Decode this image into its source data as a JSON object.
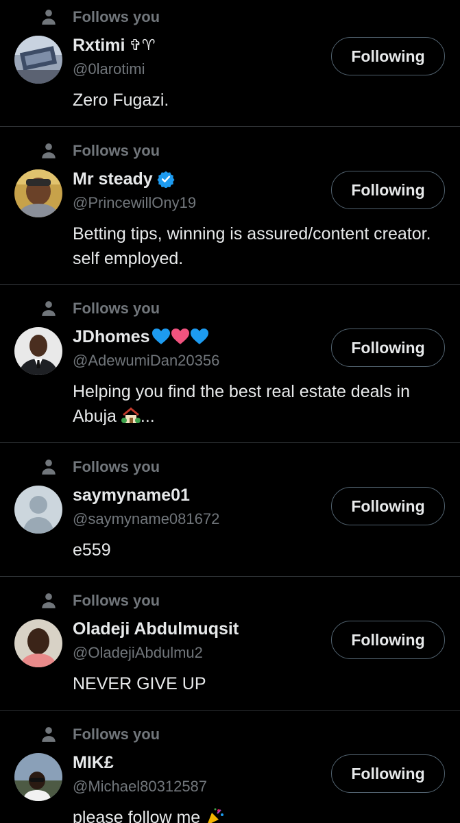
{
  "follows_label": "Follows you",
  "button_label": "Following",
  "accounts": [
    {
      "name": "Rxtimi",
      "name_suffix": "✞♈",
      "handle": "@0larotimi",
      "bio": "Zero Fugazi."
    },
    {
      "name": "Mr steady",
      "handle": "@PrincewillOny19",
      "bio": "Betting tips, winning is assured/content creator. self employed.",
      "verified": true
    },
    {
      "name": "JDhomes",
      "handle": "@AdewumiDan20356",
      "bio": "Helping you find the best real estate deals in Abuja",
      "bio_suffix": "...",
      "name_icon": "blue-pink-blue-hearts-emoji",
      "bio_icon": "house-with-garden-emoji"
    },
    {
      "name": "saymyname01",
      "handle": "@saymyname081672",
      "bio": "e559",
      "avatar": "default-avatar"
    },
    {
      "name": "Oladeji Abdulmuqsit",
      "handle": "@OladejiAbdulmu2",
      "bio": "NEVER GIVE UP"
    },
    {
      "name": "MIK£",
      "handle": "@Michael80312587",
      "bio": "please follow me",
      "bio_icon": "party-popper-emoji"
    }
  ],
  "colors": {
    "background": "#000000",
    "primary_text": "#e7e9ea",
    "secondary_text": "#71767b",
    "divider": "#2f3336",
    "button_border": "#536471",
    "verified_blue": "#1d9bf0"
  }
}
